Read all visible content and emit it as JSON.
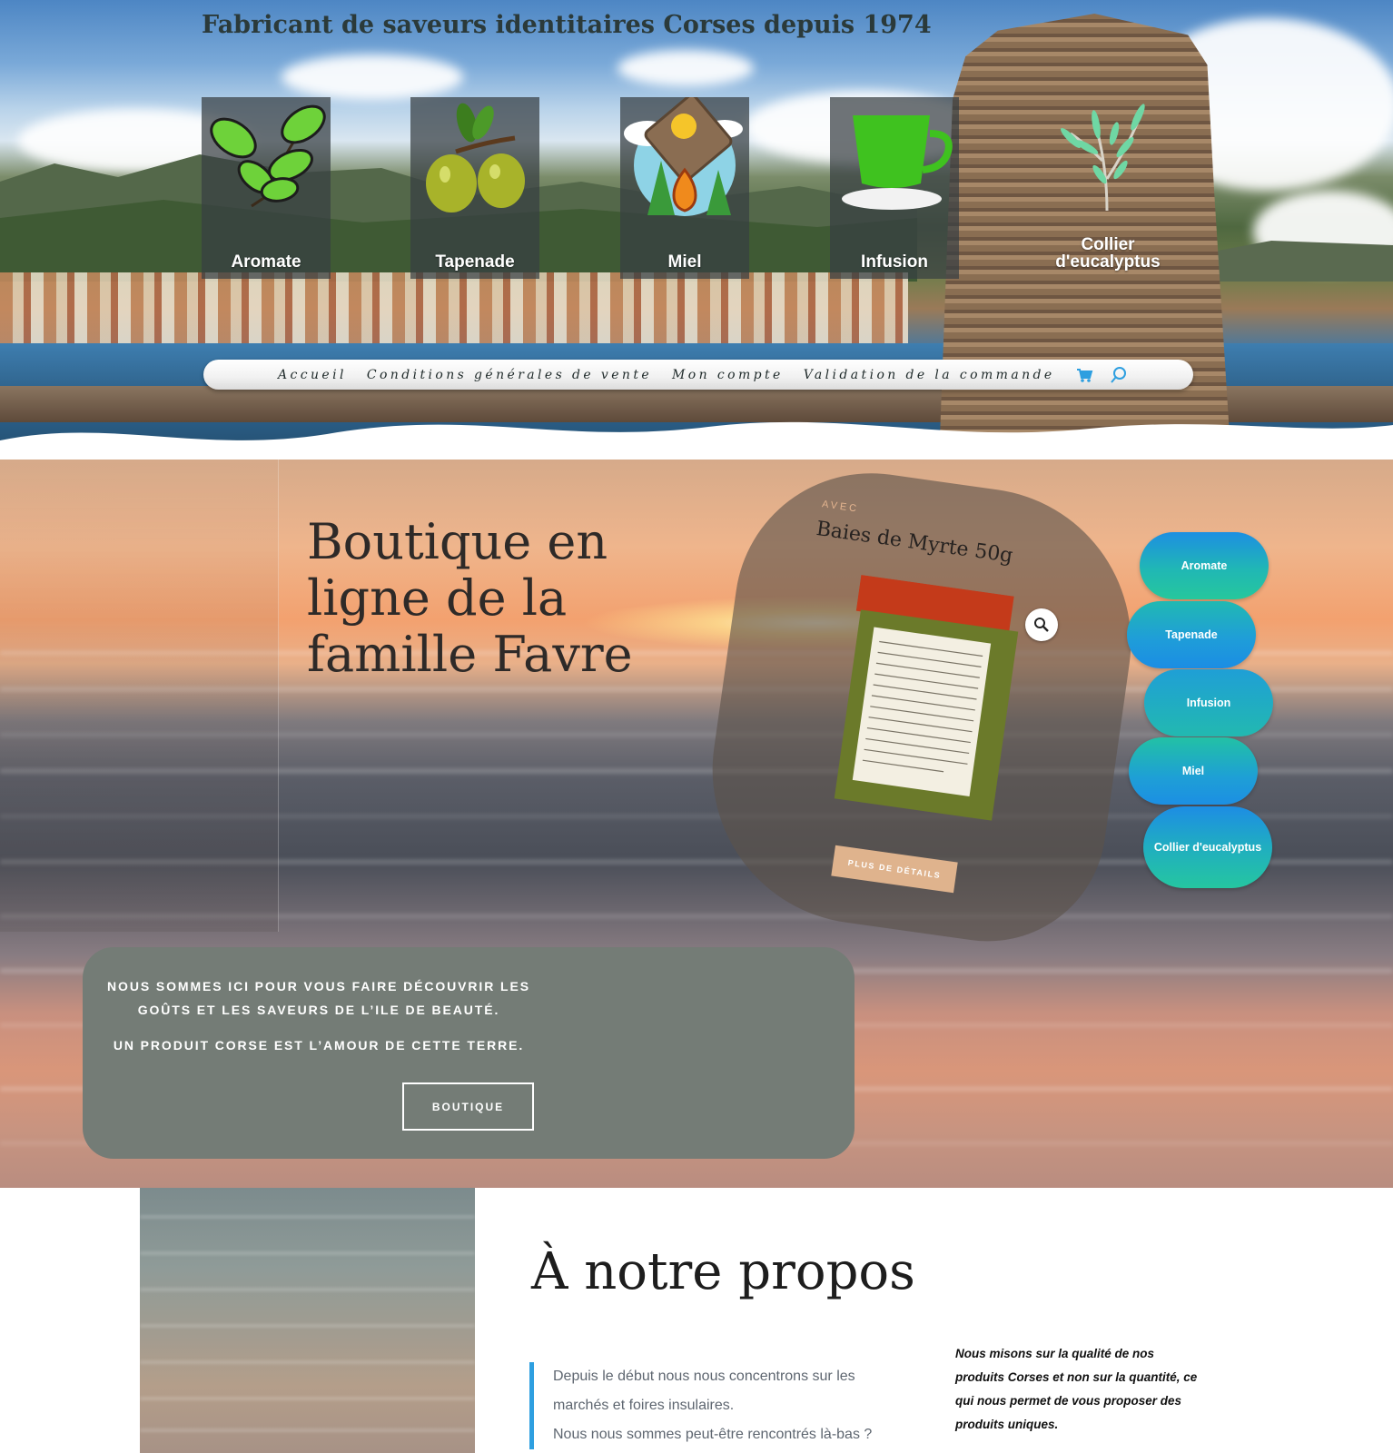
{
  "header": {
    "tagline": "Fabricant de saveurs identitaires Corses depuis 1974"
  },
  "categories": [
    {
      "label": "Aromate",
      "icon": "basil-leaves-icon"
    },
    {
      "label": "Tapenade",
      "icon": "olives-icon"
    },
    {
      "label": "Miel",
      "icon": "honey-comb-icon"
    },
    {
      "label": "Infusion",
      "icon": "tea-cup-icon"
    },
    {
      "label": "Collier d'eucalyptus",
      "icon": "eucalyptus-branch-icon"
    }
  ],
  "nav": {
    "links": [
      "Accueil",
      "Conditions générales de vente",
      "Mon compte",
      "Validation de la commande"
    ],
    "cart_icon": "cart-icon",
    "search_icon": "search-icon"
  },
  "shop": {
    "title": "Boutique en ligne de la famille Favre",
    "product": {
      "pre_label": "AVEC",
      "name": "Baies de Myrte 50g",
      "details_button": "PLUS DE DÉTAILS"
    },
    "side_links": [
      "Aromate",
      "Tapenade",
      "Infusion",
      "Miel",
      "Collier d'eucalyptus"
    ],
    "intro": {
      "line1": "NOUS SOMMES ICI POUR VOUS FAIRE DÉCOUVRIR LES",
      "line2": "GOÛTS ET LES SAVEURS DE L’ILE DE BEAUTÉ.",
      "line3": "UN PRODUIT CORSE EST L’AMOUR DE CETTE TERRE.",
      "button": "BOUTIQUE"
    }
  },
  "about": {
    "title": "À notre propos",
    "quote_lines": [
      "Depuis le début nous nous concentrons sur les",
      "marchés et foires insulaires.",
      "Nous nous sommes peut-être rencontrés là-bas ?"
    ],
    "side_text": "Nous misons sur la qualité de nos produits Corses et non sur la quantité, ce qui nous permet de vous proposer des produits uniques."
  },
  "colors": {
    "accent_blue": "#2e9fe0",
    "pill_gradient_top": "#1d8fe2",
    "pill_gradient_bottom": "#26c79c",
    "intro_box": "#747c76",
    "details_button": "#dfb38d"
  }
}
